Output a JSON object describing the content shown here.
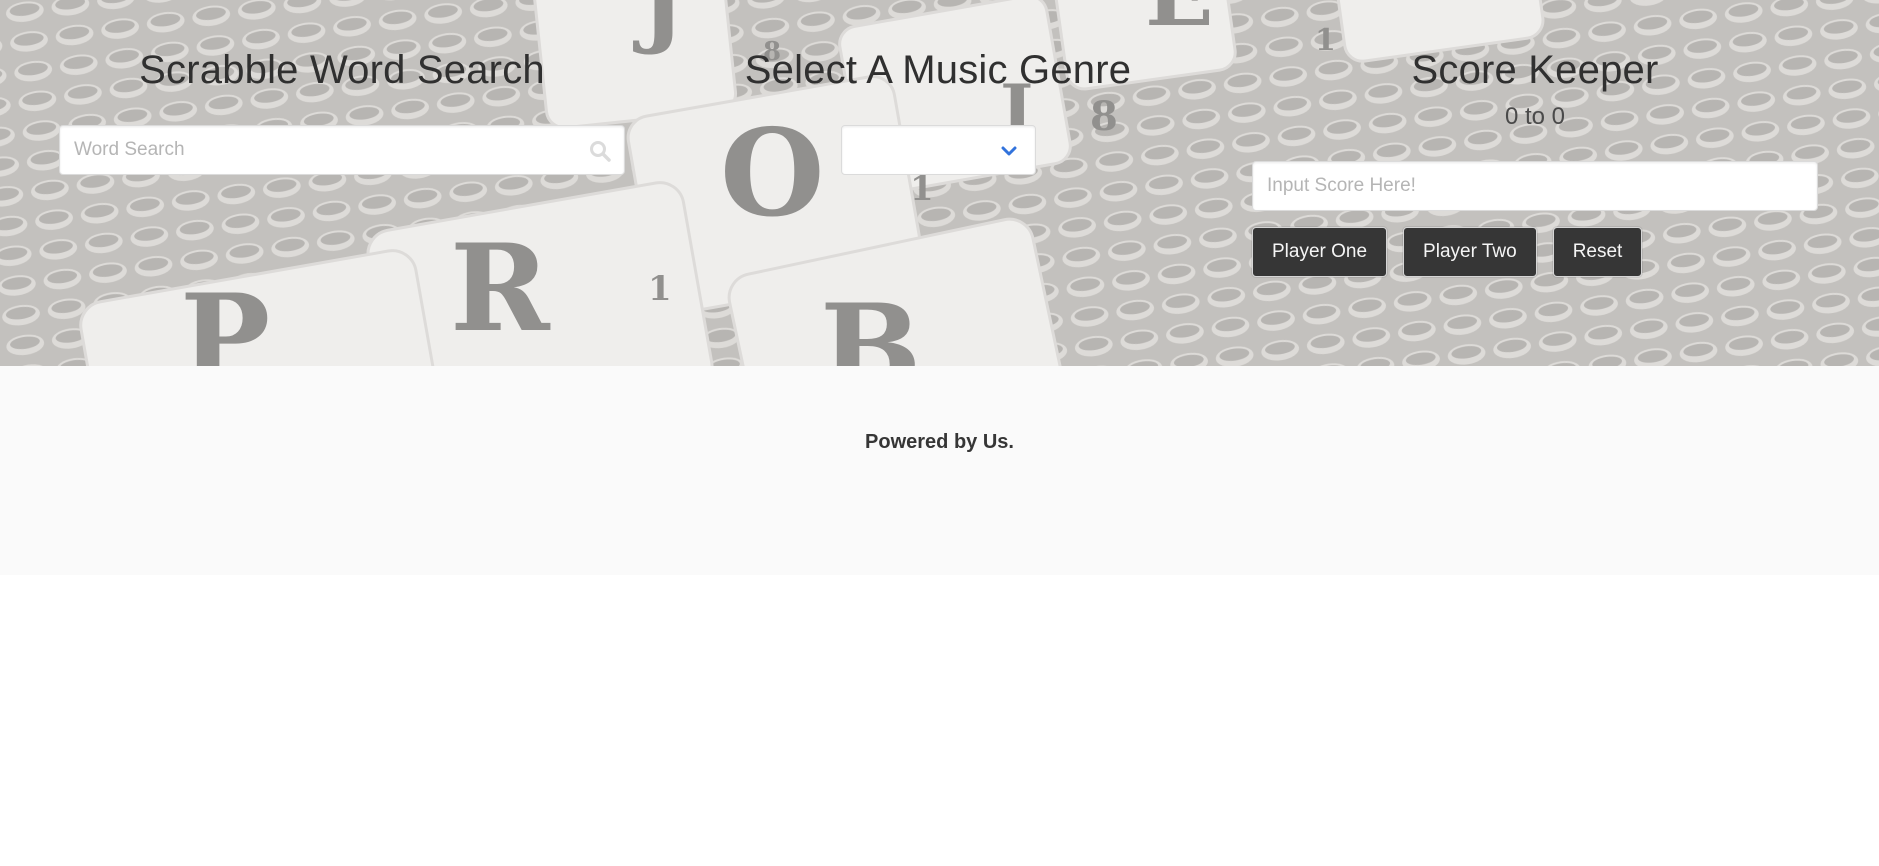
{
  "word_search": {
    "title": "Scrabble Word Search",
    "placeholder": "Word Search",
    "value": ""
  },
  "genre": {
    "title": "Select A Music Genre",
    "selected": ""
  },
  "score_keeper": {
    "title": "Score Keeper",
    "display": "0 to 0",
    "input_placeholder": "Input Score Here!",
    "input_value": "",
    "buttons": {
      "player_one": "Player One",
      "player_two": "Player Two",
      "reset": "Reset"
    }
  },
  "footer": {
    "text": "Powered by Us."
  },
  "icons": {
    "search": "search-icon",
    "dropdown": "chevron-down-icon"
  },
  "colors": {
    "button_bg": "#363636",
    "footer_bg": "#fafafa",
    "chevron": "#3273dc"
  }
}
